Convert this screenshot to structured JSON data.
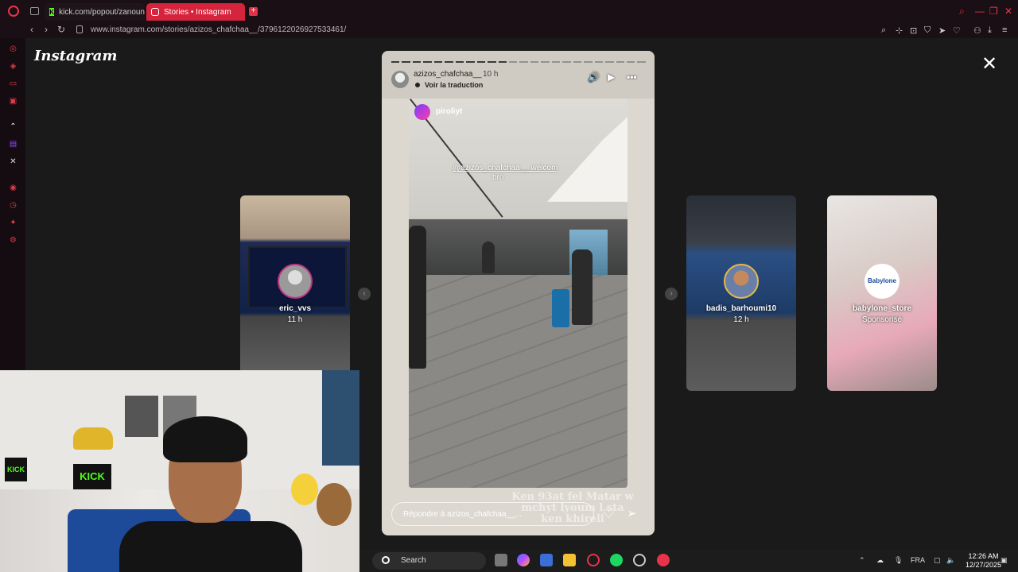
{
  "browser": {
    "tabs": [
      {
        "label": "kick.com/popout/zanoun"
      },
      {
        "label": "Stories • Instagram"
      }
    ],
    "new_tab": "+",
    "url": "www.instagram.com/stories/azizos_chafchaa__/3796122026927533461/",
    "window_controls": {
      "minimize": "—",
      "maximize": "❐",
      "close": "✕"
    }
  },
  "instagram": {
    "logo": "Instagram",
    "close": "✕",
    "main_story": {
      "username": "azizos_chafchaa__",
      "time": "10 h",
      "translate": "Voir la traduction",
      "inner_username": "piroliyt",
      "mention": "@azizos_chafchaa__ welcom",
      "mention_line2": "bro",
      "caption": "Ken 93at fel Matar w mchyt lyoum l sta ken khireli",
      "reply_placeholder": "Répondre à azizos_chafchaa__...",
      "progress_segments": 24,
      "progress_done": 11
    },
    "side_stories": [
      {
        "name": "eric_vvs",
        "time": "11 h"
      },
      {
        "name": "badis_barhoumi10",
        "time": "12 h"
      },
      {
        "name": "babylone_store",
        "time": "Sponsorisé",
        "avatar_text": "Babylone"
      }
    ],
    "webcam": {
      "kick_small": "KICK",
      "kick_big": "KICK"
    }
  },
  "taskbar": {
    "search": "Search",
    "language": "FRA",
    "time": "12:26 AM",
    "date": "12/27/2025"
  }
}
